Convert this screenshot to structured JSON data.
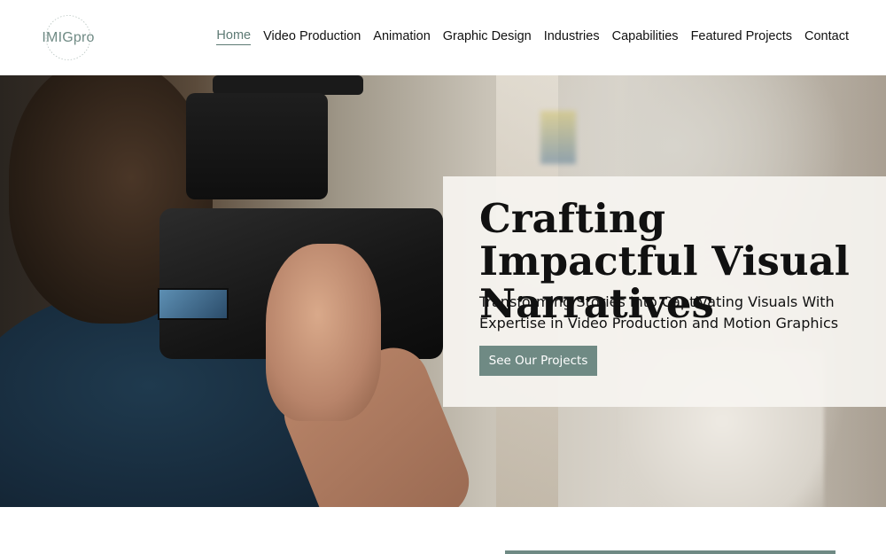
{
  "brand": {
    "logo_text": "IMIGpro"
  },
  "nav": {
    "items": [
      {
        "label": "Home",
        "active": true
      },
      {
        "label": "Video Production"
      },
      {
        "label": "Animation"
      },
      {
        "label": "Graphic Design"
      },
      {
        "label": "Industries"
      },
      {
        "label": "Capabilities"
      },
      {
        "label": "Featured Projects"
      },
      {
        "label": "Contact"
      }
    ]
  },
  "hero": {
    "image_subject": "camera operator filming",
    "title": "Crafting Impactful Visual Narratives",
    "subtitle": "Transforming Stories Into Captivating Visuals With Expertise in Video Production and Motion Graphics",
    "cta_label": "See Our Projects"
  },
  "colors": {
    "accent": "#6f8a84",
    "text": "#111111",
    "background": "#ffffff"
  }
}
